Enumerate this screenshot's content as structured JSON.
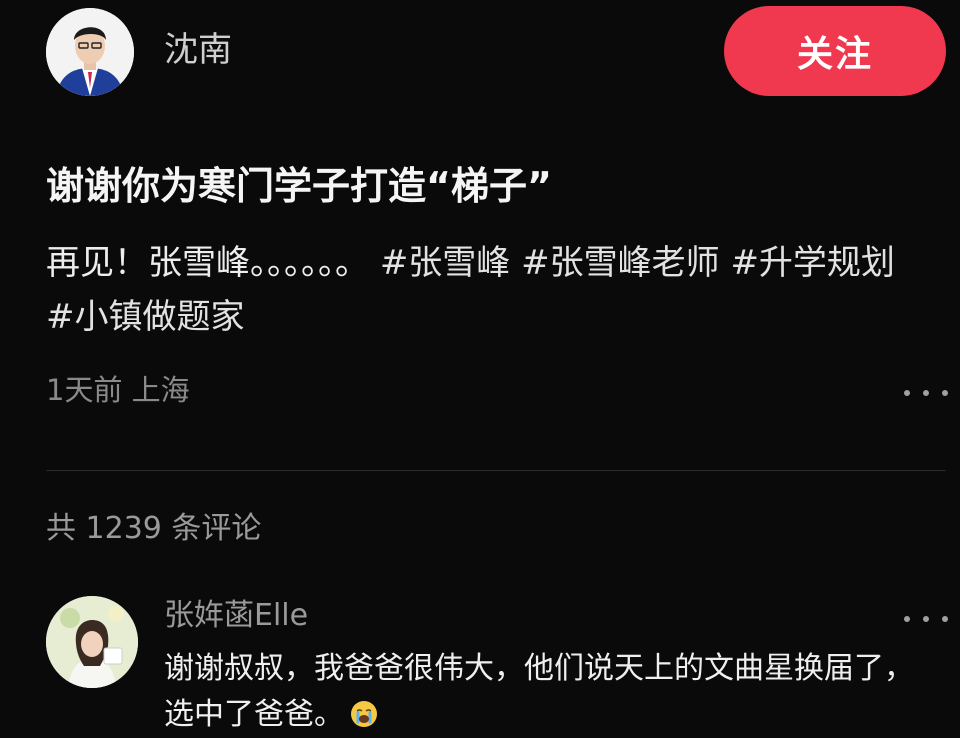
{
  "author": {
    "name": "沈南",
    "follow_label": "关注"
  },
  "post": {
    "title": "谢谢你为寒门学子打造“梯子”",
    "body_text": "再见！张雪峰。。。。。。",
    "hashtags": [
      "#张雪峰",
      "#张雪峰老师",
      "#升学规划",
      "#小镇做题家"
    ],
    "meta": "1天前 上海"
  },
  "comments": {
    "count_label": "共 1239 条评论",
    "items": [
      {
        "user": "张姩菡Elle",
        "text": "谢谢叔叔，我爸爸很伟大，他们说天上的文曲星换届了，选中了爸爸。",
        "emoji": "crying-face"
      }
    ]
  },
  "colors": {
    "background": "#0a0a0a",
    "follow_button": "#f0384f",
    "muted_text": "#8a8a8a"
  }
}
